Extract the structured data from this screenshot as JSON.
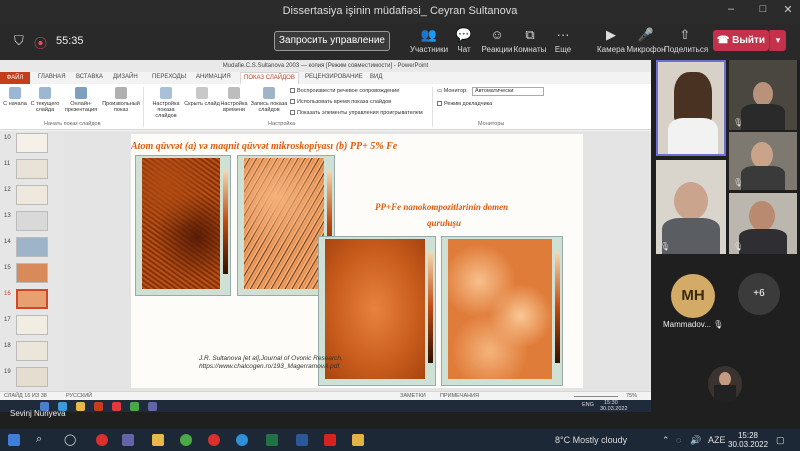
{
  "window": {
    "title": "Dissertasiya işinin müdafiəsi_ Ceyran Sultanova"
  },
  "meeting": {
    "timer": "55:35",
    "request_control": "Запросить управление",
    "participants": "Участники",
    "chat": "Чат",
    "reactions": "Реакции",
    "rooms": "Комнаты",
    "more": "Еще",
    "camera": "Камера",
    "mic": "Микрофон",
    "share": "Поделиться",
    "leave": "Выйти"
  },
  "ppt": {
    "title": "Mudafie.C.S.Sultanova 2003 — копия [Режим совместимости] - PowerPoint",
    "tabs": [
      "ФАЙЛ",
      "ГЛАВНАЯ",
      "ВСТАВКА",
      "ДИЗАЙН",
      "ПЕРЕХОДЫ",
      "АНИМАЦИЯ",
      "ПОКАЗ СЛАЙДОВ",
      "РЕЦЕНЗИРОВАНИЕ",
      "ВИД"
    ],
    "ribbon": {
      "from_start": "С начала",
      "from_current": "С текущего слайда",
      "online": "Онлайн-презентация",
      "custom": "Произвольный показ",
      "group_start": "Начать показ слайдов",
      "setup": "Настройка показа слайдов",
      "hide": "Скрыть слайд",
      "timings": "Настройка времени",
      "record": "Запись показа слайдов",
      "chk1": "Воспроизвести речевое сопровождение",
      "chk2": "Использовать время показа слайдов",
      "chk3": "Показать элементы управления проигрывателем",
      "group_setup": "Настройка",
      "monitor_label": "Монитор:",
      "monitor_value": "Автоматически",
      "presenter": "Режим докладчика",
      "group_monitors": "Мониторы"
    },
    "thumb_numbers": [
      "10",
      "11",
      "12",
      "13",
      "14",
      "15",
      "16",
      "17",
      "18",
      "19"
    ],
    "slide": {
      "heading": "Atom qüvvət (a) və maqnit qüvvət mikroskopiyası (b) PP+ 5% Fe",
      "subtitle1": "PP+Fe nanokompozitlərinin domen",
      "subtitle2": "quruluşu",
      "citation": "J.R. Sultanova [et al],Journal of Ovonic Research, https://www.chalcogen.ro/193_MagerramovA.pdf"
    },
    "status": {
      "slide_count": "СЛАЙД 16 ИЗ 38",
      "language": "РУССКИЙ",
      "notes": "ЗАМЕТКИ",
      "comments": "ПРИМЕЧАНИЯ",
      "zoom": "75%"
    },
    "inner_taskbar": {
      "lang": "ENG",
      "time": "15:30",
      "date": "30.03.2022"
    }
  },
  "sharer": {
    "name": "Sevinj Nuriyeva"
  },
  "participants": {
    "mh_initials": "MH",
    "mh_name": "Mammadov...",
    "more_count": "+6"
  },
  "taskbar": {
    "weather": "8°C  Mostly cloudy",
    "lang": "AZE",
    "time": "15:28",
    "date": "30.03.2022"
  }
}
